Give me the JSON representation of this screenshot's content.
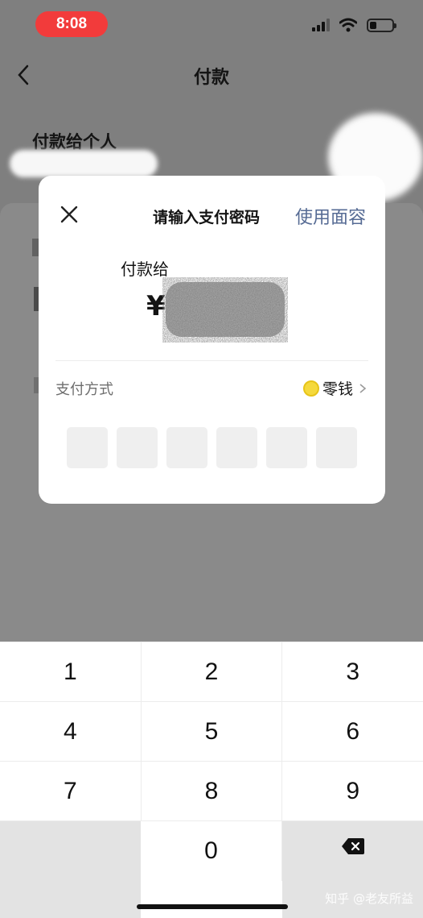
{
  "status_bar": {
    "time": "8:08"
  },
  "header": {
    "title": "付款"
  },
  "background": {
    "pay_to_person": "付款给个人"
  },
  "modal": {
    "title": "请输入支付密码",
    "face_link": "使用面容",
    "payee_label": "付款给",
    "currency": "¥",
    "payment_method_label": "支付方式",
    "payment_method_value": "零钱",
    "pin_length": 6
  },
  "keypad": {
    "rows": [
      [
        "1",
        "2",
        "3"
      ],
      [
        "4",
        "5",
        "6"
      ],
      [
        "7",
        "8",
        "9"
      ]
    ],
    "zero": "0"
  },
  "watermark": "知乎 @老友所益"
}
